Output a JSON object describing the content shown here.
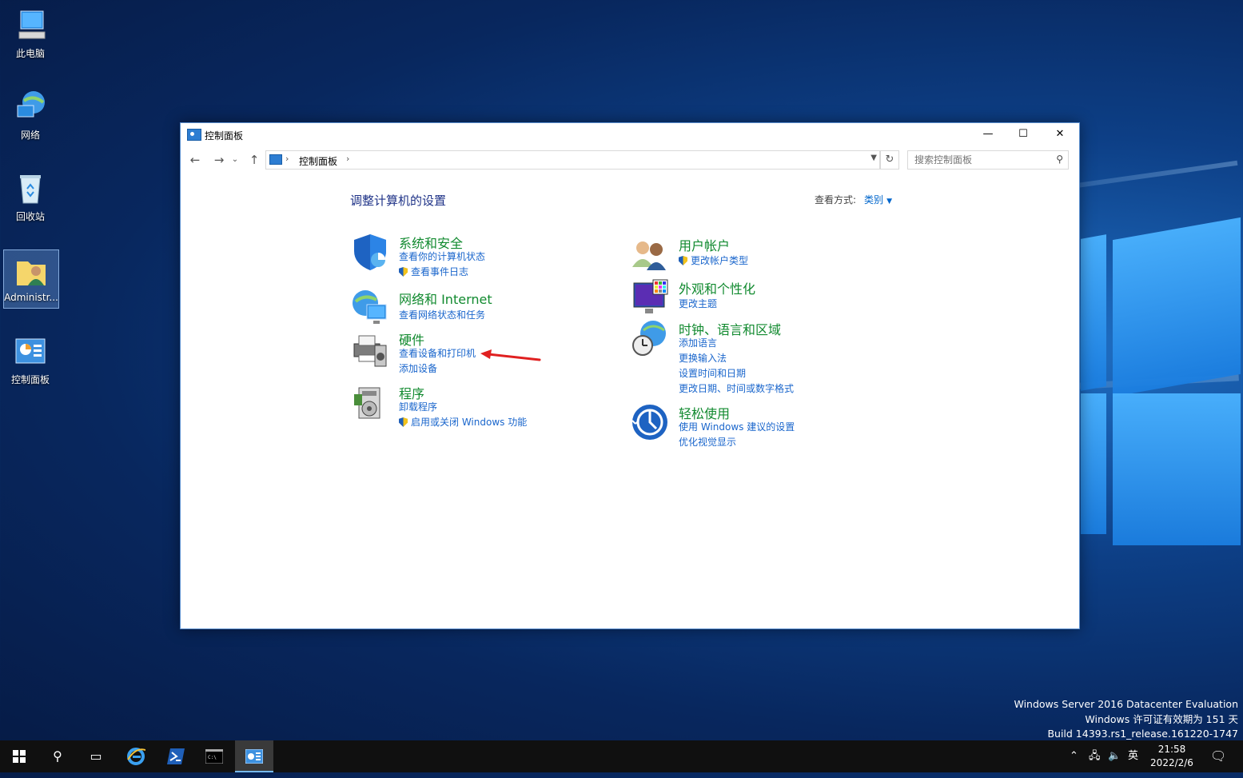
{
  "desktop": {
    "icons": [
      {
        "label": "此电脑",
        "icon": "computer-icon"
      },
      {
        "label": "网络",
        "icon": "network-icon"
      },
      {
        "label": "回收站",
        "icon": "recycle-bin-icon"
      },
      {
        "label": "Administr...",
        "icon": "user-folder-icon"
      },
      {
        "label": "控制面板",
        "icon": "control-panel-icon"
      }
    ],
    "watermark": [
      "Windows Server 2016 Datacenter Evaluation",
      "Windows 许可证有效期为 151 天",
      "Build 14393.rs1_release.161220-1747"
    ]
  },
  "window": {
    "title": "控制面板",
    "controls": {
      "minimize": "—",
      "maximize": "☐",
      "close": "✕"
    },
    "nav": {
      "back": "←",
      "forward": "→",
      "recent": "⌄",
      "up": "↑"
    },
    "address": {
      "breadcrumb": "控制面板",
      "separator": "›"
    },
    "search": {
      "placeholder": "搜索控制面板"
    },
    "heading": "调整计算机的设置",
    "view_by": {
      "label": "查看方式:",
      "value": "类别"
    },
    "categories_left": [
      {
        "title": "系统和安全",
        "icon": "system-security-shield-icon",
        "links": [
          {
            "text": "查看你的计算机状态",
            "shield": false
          },
          {
            "text": "查看事件日志",
            "shield": true
          }
        ]
      },
      {
        "title": "网络和 Internet",
        "icon": "network-internet-icon",
        "links": [
          {
            "text": "查看网络状态和任务",
            "shield": false
          }
        ]
      },
      {
        "title": "硬件",
        "icon": "hardware-printer-icon",
        "links": [
          {
            "text": "查看设备和打印机",
            "shield": false
          },
          {
            "text": "添加设备",
            "shield": false
          }
        ]
      },
      {
        "title": "程序",
        "icon": "programs-icon",
        "links": [
          {
            "text": "卸载程序",
            "shield": false
          },
          {
            "text": "启用或关闭 Windows 功能",
            "shield": true
          }
        ]
      }
    ],
    "categories_right": [
      {
        "title": "用户帐户",
        "icon": "user-accounts-icon",
        "links": [
          {
            "text": "更改帐户类型",
            "shield": true
          }
        ]
      },
      {
        "title": "外观和个性化",
        "icon": "appearance-icon",
        "links": [
          {
            "text": "更改主题",
            "shield": false
          }
        ]
      },
      {
        "title": "时钟、语言和区域",
        "icon": "clock-language-icon",
        "links": [
          {
            "text": "添加语言",
            "shield": false
          },
          {
            "text": "更换输入法",
            "shield": false
          },
          {
            "text": "设置时间和日期",
            "shield": false
          },
          {
            "text": "更改日期、时间或数字格式",
            "shield": false
          }
        ]
      },
      {
        "title": "轻松使用",
        "icon": "ease-of-access-icon",
        "links": [
          {
            "text": "使用 Windows 建议的设置",
            "shield": false
          },
          {
            "text": "优化视觉显示",
            "shield": false
          }
        ]
      }
    ]
  },
  "taskbar": {
    "apps": [
      "start-icon",
      "search-icon",
      "task-view-icon",
      "ie-icon",
      "powershell-icon",
      "cmd-icon",
      "control-panel-icon"
    ],
    "tray": {
      "input_method": "英"
    },
    "clock": {
      "time": "21:58",
      "date": "2022/2/6"
    }
  },
  "colors": {
    "category_green": "#118a2f",
    "link_blue": "#1a66cc",
    "heading_blue": "#1e3287",
    "annotation_red": "#e02020"
  }
}
